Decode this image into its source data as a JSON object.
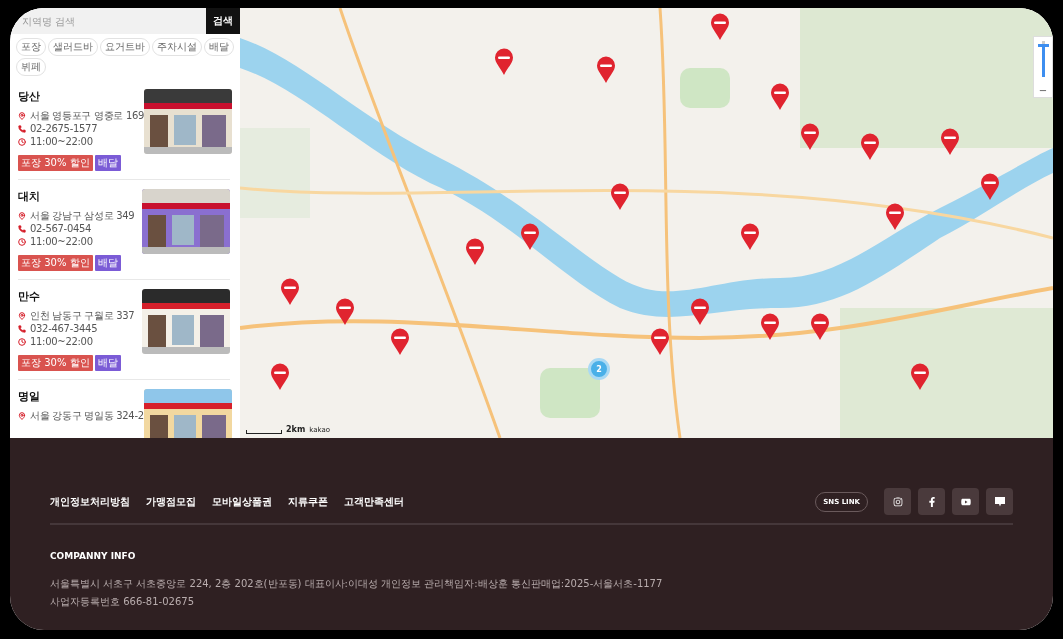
{
  "search": {
    "placeholder": "지역명 검색",
    "button": "검색"
  },
  "filters": [
    {
      "label": "포장"
    },
    {
      "label": "샐러드바"
    },
    {
      "label": "요거트바"
    },
    {
      "label": "주차시설"
    },
    {
      "label": "배달"
    },
    {
      "label": "뷔페"
    }
  ],
  "stores": [
    {
      "name": "당산",
      "address": "서울 영등포구 영중로 169",
      "phone": "02-2675-1577",
      "hours": "11:00~22:00",
      "tags": [
        {
          "label": "포장 30% 할인",
          "kind": "discount"
        },
        {
          "label": "배달",
          "kind": "delivery"
        }
      ]
    },
    {
      "name": "대치",
      "address": "서울 강남구 삼성로 349",
      "phone": "02-567-0454",
      "hours": "11:00~22:00",
      "tags": [
        {
          "label": "포장 30% 할인",
          "kind": "discount"
        },
        {
          "label": "배달",
          "kind": "delivery"
        }
      ]
    },
    {
      "name": "만수",
      "address": "인천 남동구 구월로 337",
      "phone": "032-467-3445",
      "hours": "11:00~22:00",
      "tags": [
        {
          "label": "포장 30% 할인",
          "kind": "discount"
        },
        {
          "label": "배달",
          "kind": "delivery"
        }
      ]
    },
    {
      "name": "명일",
      "address": "서울 강동구 명일동 324-2"
    }
  ],
  "map": {
    "cluster_count": "2",
    "scale": "2km",
    "attribution": "kakao",
    "zoom": {
      "level": 0.9,
      "out_label": "−"
    }
  },
  "footer": {
    "links": [
      "개인정보처리방침",
      "가맹점모집",
      "모바일상품권",
      "지류쿠폰",
      "고객만족센터"
    ],
    "sns_label": "SNS LINK",
    "company_title": "COMPANNY INFO",
    "company_lines": [
      "서울특별시 서초구 서초중앙로 224, 2층 202호(반포동) 대표이사:이대성 개인정보 관리책임자:배상훈 통신판매업:2025-서울서초-1177",
      "사업자등록번호 666-81-02675"
    ]
  }
}
